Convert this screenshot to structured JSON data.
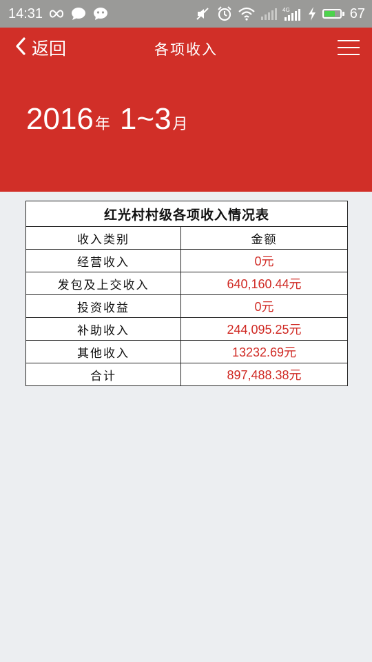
{
  "status_bar": {
    "time": "14:31",
    "battery_level": "67",
    "battery_fraction": 0.67,
    "left_icons": [
      "infinity-icon",
      "chat-bubble-icon",
      "emoticon-icon"
    ],
    "right_icons": [
      "mute-icon",
      "alarm-icon",
      "wifi-icon",
      "signal-icon",
      "4g-signal-icon",
      "charging-icon",
      "battery-icon"
    ],
    "network_label": "4G"
  },
  "header": {
    "back_label": "返回",
    "title": "各项收入",
    "date": {
      "year": "2016",
      "year_unit": "年",
      "range": "1~3",
      "month_unit": "月"
    },
    "background_color": "#d12f28"
  },
  "table": {
    "title": "红光村村级各项收入情况表",
    "headers": [
      "收入类别",
      "金额"
    ],
    "rows": [
      {
        "category": "经营收入",
        "amount": "0元"
      },
      {
        "category": "发包及上交收入",
        "amount": "640,160.44元"
      },
      {
        "category": "投资收益",
        "amount": "0元"
      },
      {
        "category": "补助收入",
        "amount": "244,095.25元"
      },
      {
        "category": "其他收入",
        "amount": "13232.69元"
      },
      {
        "category": "合计",
        "amount": "897,488.38元"
      }
    ],
    "amount_color": "#d02a24"
  }
}
